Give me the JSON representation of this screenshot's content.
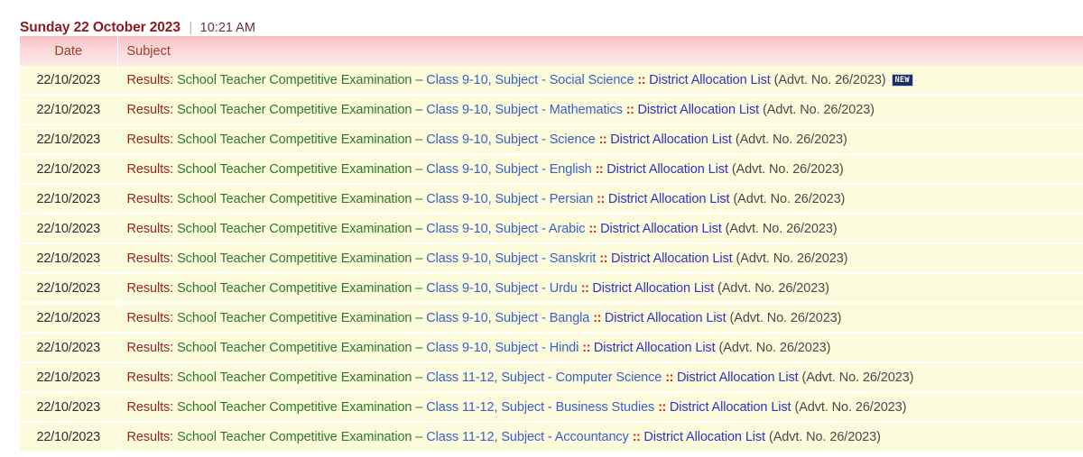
{
  "header": {
    "date": "Sunday 22 October 2023",
    "separator": "|",
    "time": "10:21 AM"
  },
  "table": {
    "columns": {
      "date": "Date",
      "subject": "Subject"
    },
    "new_badge_label": "NEW",
    "rows": [
      {
        "date": "22/10/2023",
        "results_label": "Results:",
        "exam": "School Teacher Competitive Examination –",
        "class_subject": "Class 9-10, Subject - Social Science",
        "colons": "::",
        "document": "District Allocation List",
        "advt": "(Advt. No. 26/2023)",
        "is_new": true
      },
      {
        "date": "22/10/2023",
        "results_label": "Results:",
        "exam": "School Teacher Competitive Examination –",
        "class_subject": "Class 9-10, Subject - Mathematics",
        "colons": "::",
        "document": "District Allocation List",
        "advt": "(Advt. No. 26/2023)",
        "is_new": false
      },
      {
        "date": "22/10/2023",
        "results_label": "Results:",
        "exam": "School Teacher Competitive Examination –",
        "class_subject": "Class 9-10, Subject - Science",
        "colons": "::",
        "document": "District Allocation List",
        "advt": "(Advt. No. 26/2023)",
        "is_new": false
      },
      {
        "date": "22/10/2023",
        "results_label": "Results:",
        "exam": "School Teacher Competitive Examination –",
        "class_subject": "Class 9-10, Subject - English",
        "colons": "::",
        "document": "District Allocation List",
        "advt": "(Advt. No. 26/2023)",
        "is_new": false
      },
      {
        "date": "22/10/2023",
        "results_label": "Results:",
        "exam": "School Teacher Competitive Examination –",
        "class_subject": "Class 9-10, Subject - Persian",
        "colons": "::",
        "document": "District Allocation List",
        "advt": "(Advt. No. 26/2023)",
        "is_new": false
      },
      {
        "date": "22/10/2023",
        "results_label": "Results:",
        "exam": "School Teacher Competitive Examination –",
        "class_subject": "Class 9-10, Subject - Arabic",
        "colons": "::",
        "document": "District Allocation List",
        "advt": "(Advt. No. 26/2023)",
        "is_new": false
      },
      {
        "date": "22/10/2023",
        "results_label": "Results:",
        "exam": "School Teacher Competitive Examination –",
        "class_subject": "Class 9-10, Subject - Sanskrit",
        "colons": "::",
        "document": "District Allocation List",
        "advt": "(Advt. No. 26/2023)",
        "is_new": false
      },
      {
        "date": "22/10/2023",
        "results_label": "Results:",
        "exam": "School Teacher Competitive Examination –",
        "class_subject": "Class 9-10, Subject - Urdu",
        "colons": "::",
        "document": "District Allocation List",
        "advt": "(Advt. No. 26/2023)",
        "is_new": false
      },
      {
        "date": "22/10/2023",
        "results_label": "Results:",
        "exam": "School Teacher Competitive Examination –",
        "class_subject": "Class 9-10, Subject - Bangla",
        "colons": "::",
        "document": "District Allocation List",
        "advt": "(Advt. No. 26/2023)",
        "is_new": false
      },
      {
        "date": "22/10/2023",
        "results_label": "Results:",
        "exam": "School Teacher Competitive Examination –",
        "class_subject": "Class 9-10, Subject - Hindi",
        "colons": "::",
        "document": "District Allocation List",
        "advt": "(Advt. No. 26/2023)",
        "is_new": false
      },
      {
        "date": "22/10/2023",
        "results_label": "Results:",
        "exam": "School Teacher Competitive Examination –",
        "class_subject": "Class 11-12, Subject - Computer Science",
        "colons": "::",
        "document": "District Allocation List",
        "advt": "(Advt. No. 26/2023)",
        "is_new": false
      },
      {
        "date": "22/10/2023",
        "results_label": "Results:",
        "exam": "School Teacher Competitive Examination –",
        "class_subject": "Class 11-12, Subject - Business Studies",
        "colons": "::",
        "document": "District Allocation List",
        "advt": "(Advt. No. 26/2023)",
        "is_new": false
      },
      {
        "date": "22/10/2023",
        "results_label": "Results:",
        "exam": "School Teacher Competitive Examination –",
        "class_subject": "Class 11-12, Subject - Accountancy",
        "colons": "::",
        "document": "District Allocation List",
        "advt": "(Advt. No. 26/2023)",
        "is_new": false
      }
    ]
  },
  "colors": {
    "header_date": "#8c1a1a",
    "results": "#96251f",
    "exam": "#2d7a2d",
    "class_subject": "#3a5fcd",
    "colons": "#e01b1b",
    "document": "#3232c8",
    "advt": "#4a4a4a",
    "row_background": "#fcfbdc",
    "table_header_background": "#fbd9d8",
    "new_badge_background": "#1d2d63"
  }
}
